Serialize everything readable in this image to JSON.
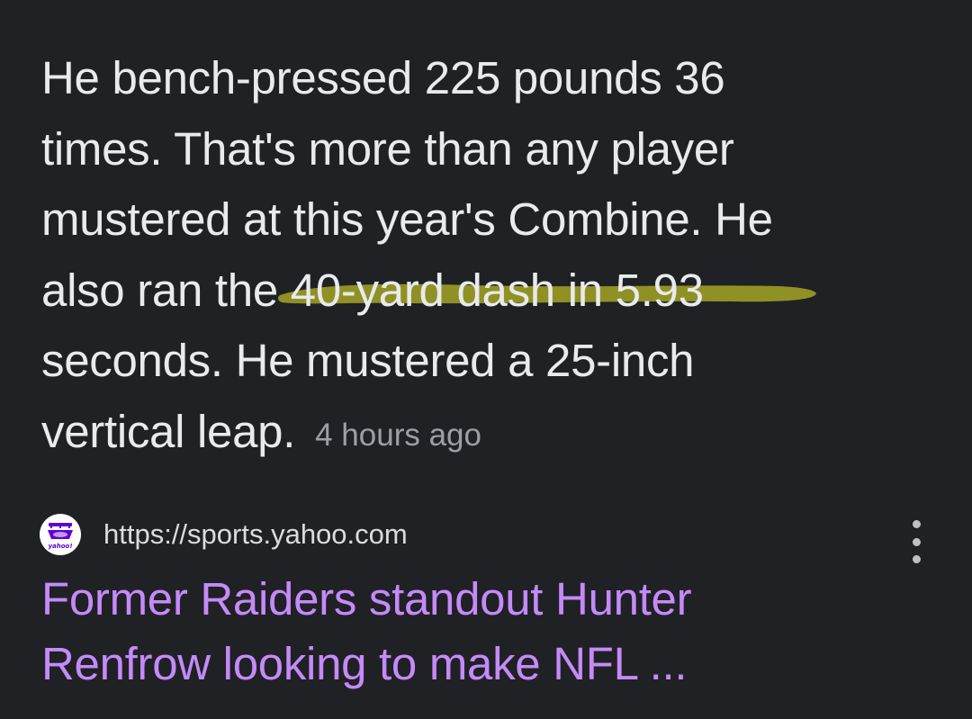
{
  "snippet": {
    "lines": [
      "He bench-pressed 225 pounds 36",
      "times. That's more than any player",
      "mustered at this year's Combine. He"
    ],
    "line4_prefix": "also ran the ",
    "line4_highlight": "40-yard dash in 5.93",
    "line5": "seconds. He mustered a 25-inch",
    "line6": "vertical leap."
  },
  "timestamp": "4 hours ago",
  "source": {
    "url": "https://sports.yahoo.com",
    "favicon_icon": "yahoo-sports-logo",
    "favicon_text": "yahoo!"
  },
  "result": {
    "title_line1": "Former Raiders standout Hunter",
    "title_line2": "Renfrow looking to make NFL ..."
  },
  "colors": {
    "background": "#202124",
    "text": "#e8eaed",
    "link": "#c58af9",
    "highlight": "#a5a524",
    "muted": "#9aa0a6"
  }
}
